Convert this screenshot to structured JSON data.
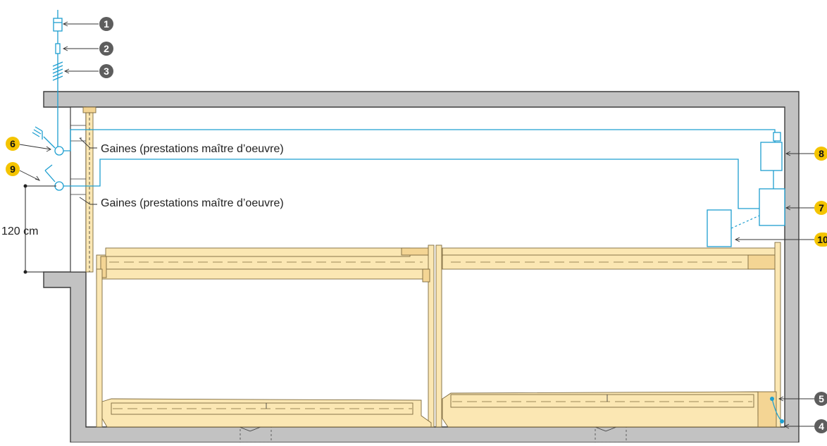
{
  "callouts": [
    {
      "number": "1",
      "style": "gray"
    },
    {
      "number": "2",
      "style": "gray"
    },
    {
      "number": "3",
      "style": "gray"
    },
    {
      "number": "4",
      "style": "gray"
    },
    {
      "number": "5",
      "style": "gray"
    },
    {
      "number": "6",
      "style": "yellow"
    },
    {
      "number": "7",
      "style": "yellow"
    },
    {
      "number": "8",
      "style": "yellow"
    },
    {
      "number": "9",
      "style": "yellow"
    },
    {
      "number": "10",
      "style": "yellow"
    }
  ],
  "labels": {
    "gaines_top": "Gaines (prestations maître d’oeuvre)",
    "gaines_bottom": "Gaines (prestations maître d’oeuvre)",
    "height_dimension": "120 cm"
  },
  "colors": {
    "wall": "#c2c2c2",
    "wood": "#fbe7b3",
    "cable": "#1e9fd0",
    "callout_gray": "#5d5d5d",
    "callout_yellow": "#f4c400"
  }
}
